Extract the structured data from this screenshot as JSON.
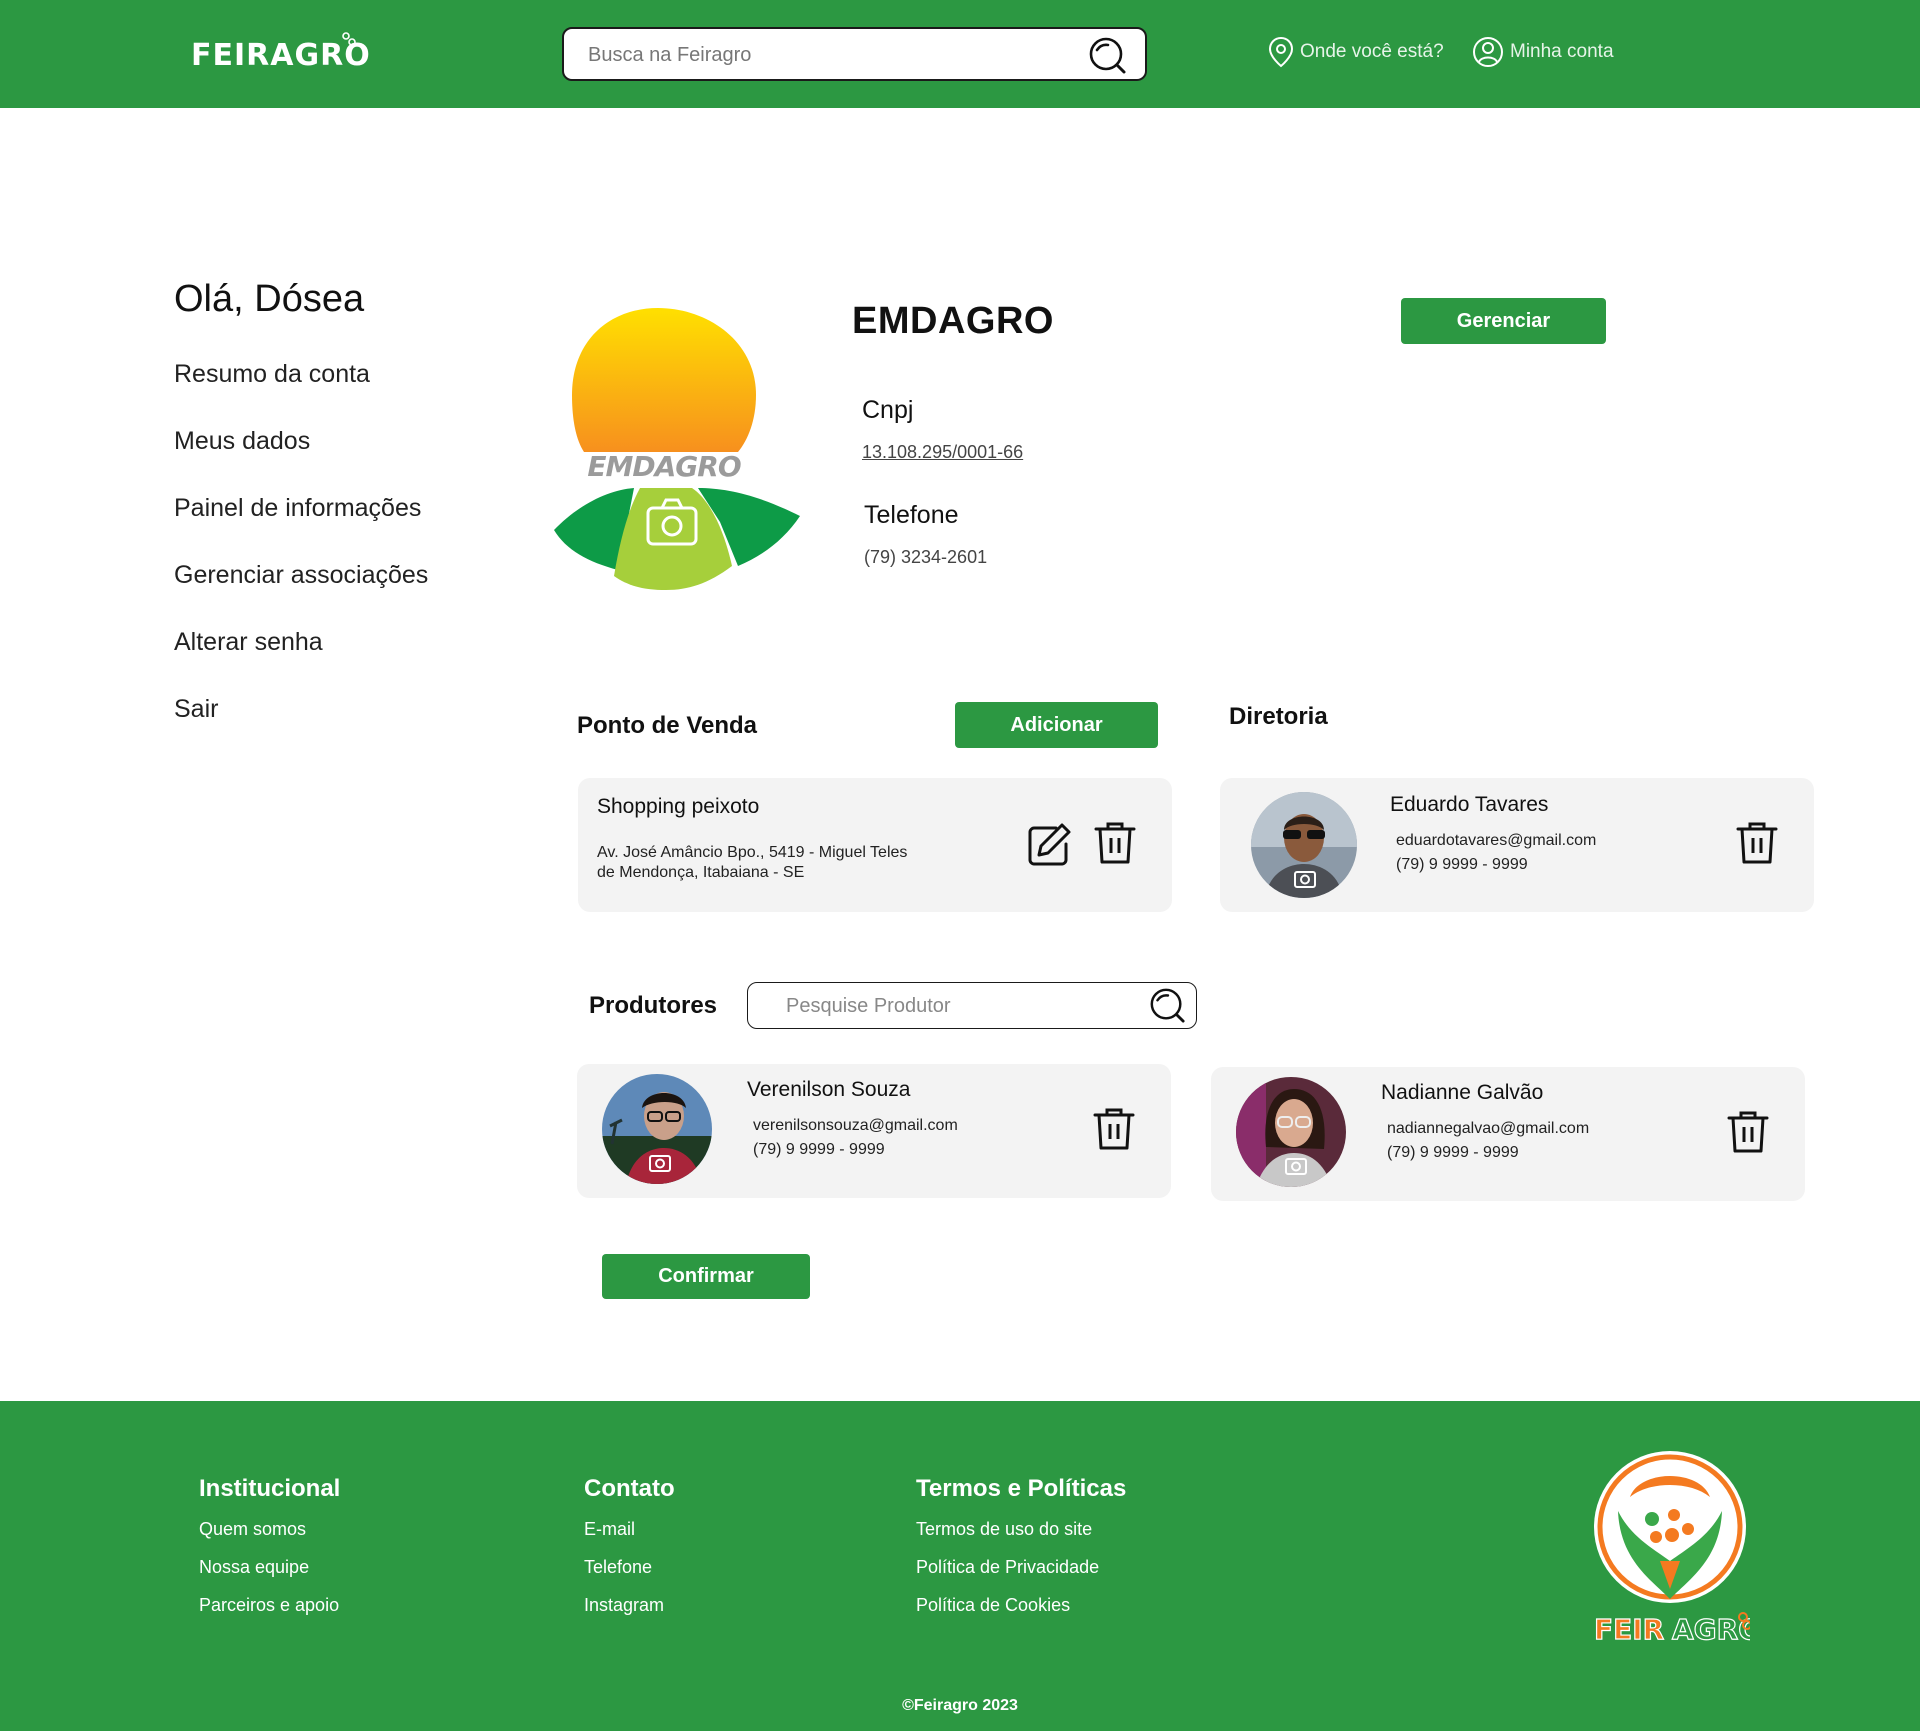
{
  "header": {
    "brand": "FEIRAGRO",
    "search_placeholder": "Busca na Feiragro",
    "location_label": "Onde você está?",
    "account_label": "Minha conta"
  },
  "sidebar": {
    "greeting": "Olá, Dósea",
    "items": [
      {
        "label": "Resumo da conta"
      },
      {
        "label": "Meus dados"
      },
      {
        "label": "Painel de informações"
      },
      {
        "label": "Gerenciar associações"
      },
      {
        "label": "Alterar senha"
      },
      {
        "label": "Sair"
      }
    ]
  },
  "profile": {
    "org_name": "EMDAGRO",
    "logo_text": "EMDAGRO",
    "manage_label": "Gerenciar",
    "cnpj_label": "Cnpj",
    "cnpj_value": "13.108.295/0001-66",
    "phone_label": "Telefone",
    "phone_value": "(79) 3234-2601"
  },
  "sales_points": {
    "title": "Ponto de Venda",
    "add_label": "Adicionar",
    "items": [
      {
        "name": "Shopping peixoto",
        "address_line1": "Av. José Amâncio Bpo., 5419 - Miguel Teles",
        "address_line2": "de Mendonça, Itabaiana - SE"
      }
    ]
  },
  "board": {
    "title": "Diretoria",
    "members": [
      {
        "name": "Eduardo Tavares",
        "email": "eduardotavares@gmail.com",
        "phone": "(79) 9 9999 - 9999"
      }
    ]
  },
  "producers": {
    "title": "Produtores",
    "search_placeholder": "Pesquise Produtor",
    "items": [
      {
        "name": "Verenilson Souza",
        "email": "verenilsonsouza@gmail.com",
        "phone": "(79) 9 9999 - 9999"
      },
      {
        "name": "Nadianne Galvão",
        "email": "nadiannegalvao@gmail.com",
        "phone": "(79) 9 9999 - 9999"
      }
    ]
  },
  "confirm_label": "Confirmar",
  "footer": {
    "columns": [
      {
        "heading": "Institucional",
        "links": [
          "Quem somos",
          "Nossa equipe",
          "Parceiros e apoio"
        ]
      },
      {
        "heading": "Contato",
        "links": [
          "E-mail",
          "Telefone",
          "Instagram"
        ]
      },
      {
        "heading": "Termos e Políticas",
        "links": [
          "Termos de uso do site",
          "Política de Privacidade",
          "Política de Cookies"
        ]
      }
    ],
    "logo_text_a": "FEIR",
    "logo_text_b": "AGRO",
    "copyright": "©Feiragro 2023"
  },
  "colors": {
    "brand_green": "#2c9842",
    "card_bg": "#f3f3f3",
    "accent_orange": "#f47a20"
  }
}
